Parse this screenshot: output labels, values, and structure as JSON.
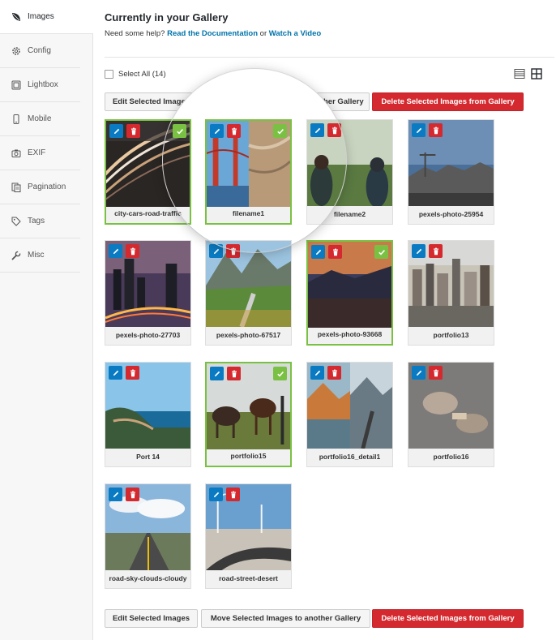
{
  "sidebar": {
    "items": [
      {
        "label": "Images",
        "icon": "leaf-icon",
        "active": true
      },
      {
        "label": "Config",
        "icon": "gear-icon",
        "active": false
      },
      {
        "label": "Lightbox",
        "icon": "lightbox-icon",
        "active": false
      },
      {
        "label": "Mobile",
        "icon": "mobile-icon",
        "active": false
      },
      {
        "label": "EXIF",
        "icon": "camera-icon",
        "active": false
      },
      {
        "label": "Pagination",
        "icon": "pages-icon",
        "active": false
      },
      {
        "label": "Tags",
        "icon": "tag-icon",
        "active": false
      },
      {
        "label": "Misc",
        "icon": "wrench-icon",
        "active": false
      }
    ]
  },
  "header": {
    "title": "Currently in your Gallery",
    "help_prefix": "Need some help?",
    "doc_link": "Read the Documentation",
    "or_text": "or",
    "video_link": "Watch a Video"
  },
  "toolbar": {
    "select_all": "Select All (14)",
    "edit_selected": "Edit Selected Images",
    "move_selected": "Move Selected Images to another Gallery",
    "delete_selected": "Delete Selected Images from Gallery"
  },
  "images": [
    {
      "name": "city-cars-road-traffic",
      "selected": true
    },
    {
      "name": "filename1",
      "selected": true
    },
    {
      "name": "filename2",
      "selected": false
    },
    {
      "name": "pexels-photo-25954",
      "selected": false
    },
    {
      "name": "pexels-photo-27703",
      "selected": false
    },
    {
      "name": "pexels-photo-67517",
      "selected": false
    },
    {
      "name": "pexels-photo-93668",
      "selected": true
    },
    {
      "name": "portfolio13",
      "selected": false
    },
    {
      "name": "Port 14",
      "selected": false
    },
    {
      "name": "portfolio15",
      "selected": true
    },
    {
      "name": "portfolio16_detail1",
      "selected": false
    },
    {
      "name": "portfolio16",
      "selected": false
    },
    {
      "name": "road-sky-clouds-cloudy",
      "selected": false
    },
    {
      "name": "road-street-desert",
      "selected": false
    }
  ],
  "magnified": {
    "name": "filename1"
  },
  "colors": {
    "accent_blue": "#0a7bc2",
    "danger_red": "#d42a2f",
    "selected_green": "#7ac143",
    "link_blue": "#0073aa"
  }
}
